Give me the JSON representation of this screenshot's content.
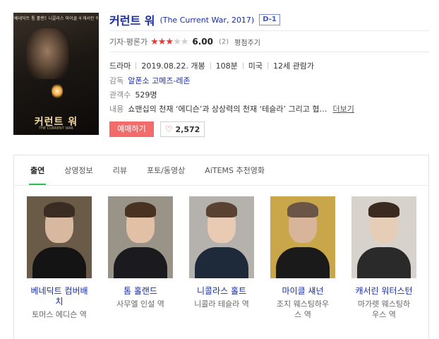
{
  "movie": {
    "title_ko": "커런트 워",
    "title_en": "(The Current War, 2017)",
    "dday": "D-1",
    "rating_label": "기자·평론가",
    "stars": 3,
    "stars_max": 5,
    "score": "6.00",
    "rating_count": "(2)",
    "rate_button": "평점주기",
    "genre": "드라마",
    "release": "2019.08.22. 개봉",
    "runtime": "108분",
    "country": "미국",
    "age": "12세 관람가",
    "director_label": "감독",
    "director": "알폰소 고메즈-레존",
    "audience_label": "관객수",
    "audience": "529명",
    "content_label": "내용",
    "content": "쇼맨십의 천재 ‘에디슨’과 상상력의 천재 ‘테슬라’ 그리고 협…",
    "more": "더보기",
    "book_button": "예매하기",
    "likes": "2,572"
  },
  "poster": {
    "names": [
      "베네딕트 컴버배치",
      "톰 홀랜드",
      "니콜라스 홀트",
      "마이클 섀넌",
      "캐서린 워터스턴"
    ],
    "title": "커런트 워",
    "subtitle": "THE CURRENT WAR"
  },
  "tabs": [
    {
      "label": "출연",
      "active": true
    },
    {
      "label": "상영정보",
      "active": false
    },
    {
      "label": "리뷰",
      "active": false
    },
    {
      "label": "포토/동영상",
      "active": false
    },
    {
      "label": "AiTEMS 추천영화",
      "active": false
    }
  ],
  "cast": [
    {
      "name": "베네딕트 컴버배\n치",
      "role": "토머스 에디슨 역",
      "skin": "#d9b8a0",
      "hair": "#3a2c22",
      "bg": "#6a5a48",
      "suit": "#141414"
    },
    {
      "name": "톰 홀랜드",
      "role": "사무엘 인설 역",
      "skin": "#e2c0a6",
      "hair": "#4a3222",
      "bg": "#9a9488",
      "suit": "#1b1b1f"
    },
    {
      "name": "니콜라스 홀트",
      "role": "니콜라 테슬라 역",
      "skin": "#e8cbb2",
      "hair": "#5a4232",
      "bg": "#b5b2ad",
      "suit": "#1e2a3a"
    },
    {
      "name": "마이클 섀넌",
      "role": "조지 웨스팅하우\n스 역",
      "skin": "#d8b59a",
      "hair": "#6a5546",
      "bg": "#c9a64a",
      "suit": "#1a1a1a"
    },
    {
      "name": "캐서린 워터스턴",
      "role": "마가렛 웨스팅하\n우스 역",
      "skin": "#e6cdb8",
      "hair": "#3b2a20",
      "bg": "#d7d2cc",
      "suit": "#2a2a2a"
    }
  ]
}
